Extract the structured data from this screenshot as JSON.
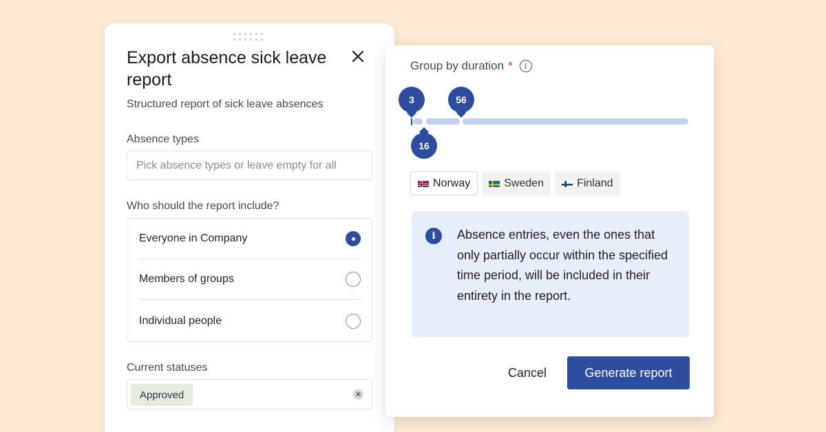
{
  "dialog": {
    "title": "Export absence sick leave report",
    "subtitle": "Structured report of sick leave absences",
    "absence_types": {
      "label": "Absence types",
      "placeholder": "Pick absence types or leave empty for all"
    },
    "include": {
      "label": "Who should the report include?",
      "options": [
        {
          "label": "Everyone in Company",
          "selected": true
        },
        {
          "label": "Members of groups",
          "selected": false
        },
        {
          "label": "Individual people",
          "selected": false
        }
      ]
    },
    "statuses": {
      "label": "Current statuses",
      "chips": [
        "Approved"
      ]
    }
  },
  "duration_panel": {
    "label": "Group by duration",
    "required_marker": "*",
    "slider_values": [
      "3",
      "16",
      "56"
    ],
    "countries": [
      {
        "name": "Norway",
        "active": true
      },
      {
        "name": "Sweden",
        "active": false
      },
      {
        "name": "Finland",
        "active": false
      }
    ],
    "notice": "Absence entries, even the ones that only partially occur within the specified time period, will be included in their entirety in the report.",
    "cancel_label": "Cancel",
    "generate_label": "Generate report"
  },
  "colors": {
    "background": "#fbe9d2",
    "accent": "#2e4d9f",
    "slider_track": "#c3d3ef",
    "notice_bg": "#e6edfb",
    "chip_approved": "#e6ecdd"
  }
}
